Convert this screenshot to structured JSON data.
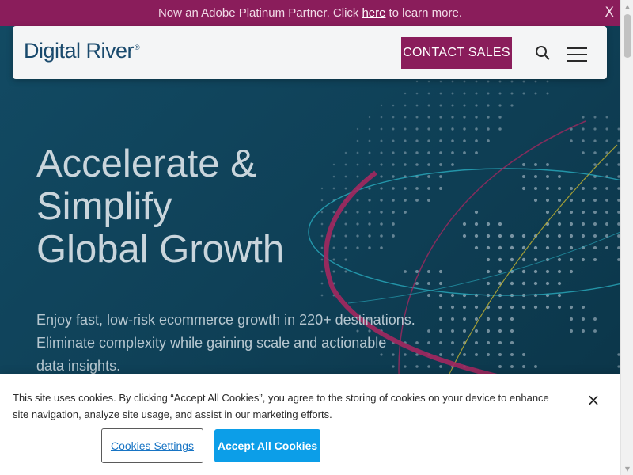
{
  "announcement": {
    "text_before": "Now an Adobe Platinum Partner. Click",
    "link": "here",
    "text_after": "to learn more.",
    "close": "X"
  },
  "nav": {
    "logo": "Digital River",
    "logo_mark": "®",
    "contact_label": "CONTACT SALES",
    "search_icon": "search-icon",
    "menu_icon": "hamburger-menu-icon"
  },
  "hero": {
    "title_lines": [
      "Accelerate &",
      "Simplify",
      "Global Growth"
    ],
    "subtitle": "Enjoy fast, low-risk ecommerce growth in 220+ destinations. Eliminate complexity while gaining scale and actionable data insights."
  },
  "cookie": {
    "text": "This site uses cookies. By clicking “Accept All Cookies”, you agree to the storing of cookies on your device to enhance site navigation, analyze site usage, and assist in our marketing efforts.",
    "close": "×",
    "settings_label": "Cookies Settings",
    "accept_label": "Accept All Cookies"
  },
  "colors": {
    "brand_magenta": "#8a1d5b",
    "hero_teal": "#0f4158",
    "accept_blue": "#0c9ee8",
    "logo_navy": "#1a4a6d"
  }
}
